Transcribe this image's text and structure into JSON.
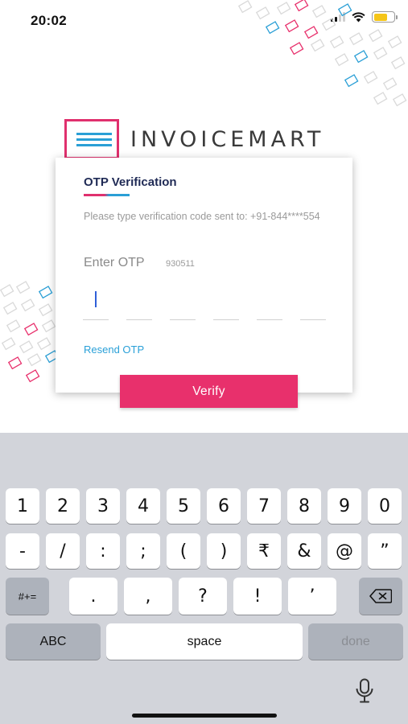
{
  "status_bar": {
    "time": "20:02",
    "icons": [
      "signal-icon",
      "wifi-icon",
      "battery-icon"
    ],
    "battery_color": "#f5c518"
  },
  "brand": {
    "name": "INVOICEMART",
    "logo_icon": "hamburger-logo-icon",
    "primary_color": "#e0306e",
    "secondary_color": "#2a9fd6"
  },
  "otp_card": {
    "title": "OTP Verification",
    "description": "Please type verification code sent to: +91-844****554",
    "label": "Enter OTP",
    "hint": "930511",
    "digits": [
      "",
      "",
      "",
      "",
      "",
      ""
    ],
    "resend_label": "Resend OTP",
    "verify_label": "Verify"
  },
  "keyboard": {
    "row1": [
      "1",
      "2",
      "3",
      "4",
      "5",
      "6",
      "7",
      "8",
      "9",
      "0"
    ],
    "row2": [
      "-",
      "/",
      ":",
      ";",
      "(",
      ")",
      "₹",
      "&",
      "@",
      "”"
    ],
    "row3_mode": "#+=",
    "row3": [
      ".",
      ",",
      "?",
      "!",
      "’"
    ],
    "delete_icon": "backspace-icon",
    "abc_label": "ABC",
    "space_label": "space",
    "done_label": "done",
    "mic_icon": "microphone-icon"
  }
}
